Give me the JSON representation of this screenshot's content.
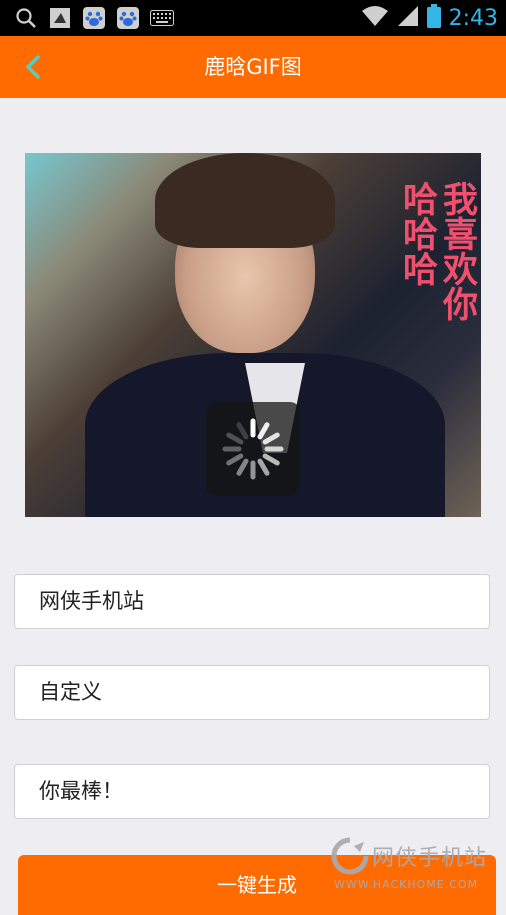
{
  "status_bar": {
    "icons": [
      "search-icon",
      "debug-icon",
      "baidu-paw-icon",
      "baidu-paw-icon",
      "keyboard-icon"
    ],
    "wifi_icon": "wifi-icon",
    "signal_icon": "signal-icon",
    "battery_icon": "battery-icon",
    "time": "2:43",
    "time_color": "#33b5e5"
  },
  "app_bar": {
    "title": "鹿晗GIF图",
    "back_icon": "chevron-left-icon",
    "color": "#ff6b00"
  },
  "gif": {
    "overlay_text_col1": "我喜欢你",
    "overlay_text_col2": "哈哈哈",
    "overlay_color": "#f0506e",
    "loading_icon": "spinner-icon"
  },
  "fields": [
    {
      "value": "网侠手机站"
    },
    {
      "value": "自定义"
    },
    {
      "value": "你最棒！"
    }
  ],
  "generate_button": {
    "label": "一键生成"
  },
  "watermark": {
    "main": "网侠手机站",
    "sub": "WWW.HACKHOME.COM"
  }
}
